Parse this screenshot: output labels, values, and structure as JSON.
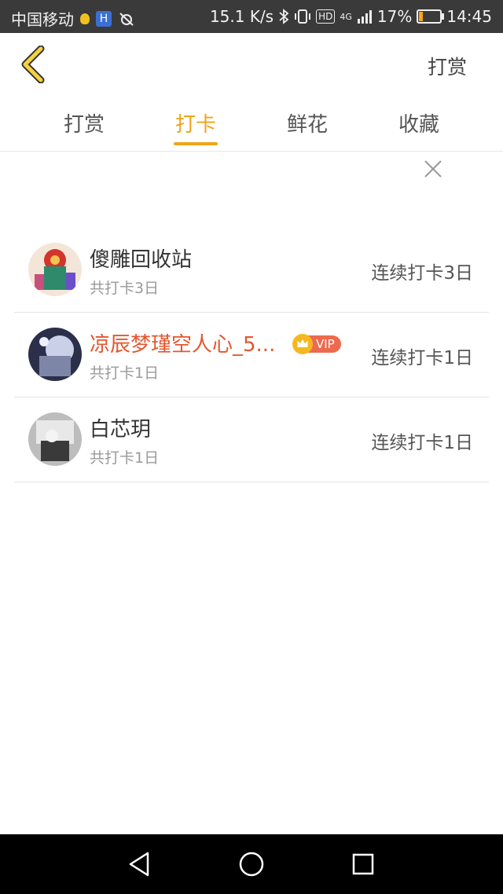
{
  "status_bar": {
    "carrier": "中国移动",
    "speed": "15.1 K/s",
    "hd": "HD",
    "network": "4G",
    "battery": "17%",
    "time": "14:45",
    "icons": [
      "lightbulb-icon",
      "h-app-icon",
      "alarm-off-icon",
      "bluetooth-icon",
      "vibrate-icon",
      "signal-icon",
      "battery-icon"
    ]
  },
  "header": {
    "back_icon": "chevron-left-icon",
    "action_label": "打赏"
  },
  "tabs": [
    {
      "label": "打赏",
      "active": false
    },
    {
      "label": "打卡",
      "active": true
    },
    {
      "label": "鲜花",
      "active": false
    },
    {
      "label": "收藏",
      "active": false
    }
  ],
  "close_icon": "close-icon",
  "list": [
    {
      "name": "傻雕回收站",
      "total": "共打卡3日",
      "streak": "连续打卡3日",
      "vip": false
    },
    {
      "name": "凉辰梦瑾空人心_5...",
      "total": "共打卡1日",
      "streak": "连续打卡1日",
      "vip": true,
      "vip_label": "VIP"
    },
    {
      "name": "白芯玥",
      "total": "共打卡1日",
      "streak": "连续打卡1日",
      "vip": false
    }
  ],
  "colors": {
    "accent": "#f0a418",
    "vip_name": "#e4572e",
    "vip_tag": "#ec6a4e"
  },
  "nav_bar": {
    "icons": [
      "back-triangle-icon",
      "home-circle-icon",
      "recents-square-icon"
    ]
  }
}
